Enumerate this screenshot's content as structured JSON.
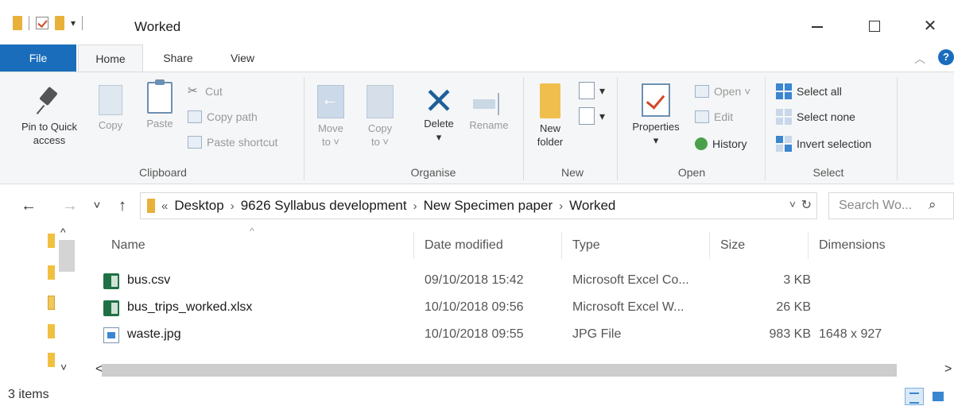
{
  "window": {
    "title": "Worked",
    "qat_arrow": "▾",
    "close_glyph": "✕"
  },
  "tabs": {
    "file": "File",
    "home": "Home",
    "share": "Share",
    "view": "View"
  },
  "ribbon": {
    "collapse_glyph": "︿",
    "help_glyph": "?",
    "clipboard": {
      "label": "Clipboard",
      "pin_line1": "Pin to Quick",
      "pin_line2": "access",
      "copy": "Copy",
      "paste": "Paste",
      "cut": "Cut",
      "copy_path": "Copy path",
      "paste_shortcut": "Paste shortcut"
    },
    "organise": {
      "label": "Organise",
      "move_line1": "Move",
      "move_line2": "to ˅",
      "copy_line1": "Copy",
      "copy_line2": "to ˅",
      "delete_line1": "Delete",
      "delete_line2": "▾",
      "rename": "Rename"
    },
    "new": {
      "label": "New",
      "new_folder_line1": "New",
      "new_folder_line2": "folder",
      "dropdown": "▾"
    },
    "open": {
      "label": "Open",
      "properties_line1": "Properties",
      "properties_line2": "▾",
      "open": "Open ˅",
      "edit": "Edit",
      "history": "History"
    },
    "select": {
      "label": "Select",
      "select_all": "Select all",
      "select_none": "Select none",
      "invert_selection": "Invert selection"
    }
  },
  "navigation": {
    "back": "←",
    "forward": "→",
    "recent": "˅",
    "up": "↑",
    "overflow": "«",
    "breadcrumb": [
      "Desktop",
      "9626 Syllabus development",
      "New Specimen paper",
      "Worked"
    ],
    "separator": "›",
    "dropdown": "˅",
    "refresh": "↻",
    "search_placeholder": "Search Wo...",
    "search_glyph": "⌕"
  },
  "navpane": {
    "scroll_up": "^",
    "scroll_down": "˅"
  },
  "file_list": {
    "sort_glyph": "^",
    "columns": {
      "name": "Name",
      "date_modified": "Date modified",
      "type": "Type",
      "size": "Size",
      "dimensions": "Dimensions"
    },
    "rows": [
      {
        "name": "bus.csv",
        "icon": "excel-csv-icon",
        "date": "09/10/2018 15:42",
        "type": "Microsoft Excel Co...",
        "size": "3 KB",
        "dimensions": ""
      },
      {
        "name": "bus_trips_worked.xlsx",
        "icon": "excel-xlsx-icon",
        "date": "10/10/2018 09:56",
        "type": "Microsoft Excel W...",
        "size": "26 KB",
        "dimensions": ""
      },
      {
        "name": "waste.jpg",
        "icon": "jpg-image-icon",
        "date": "10/10/2018 09:55",
        "type": "JPG File",
        "size": "983 KB",
        "dimensions": "1648 x 927"
      }
    ]
  },
  "hscroll": {
    "left": "<",
    "right": ">"
  },
  "status": {
    "item_count": "3 items"
  }
}
